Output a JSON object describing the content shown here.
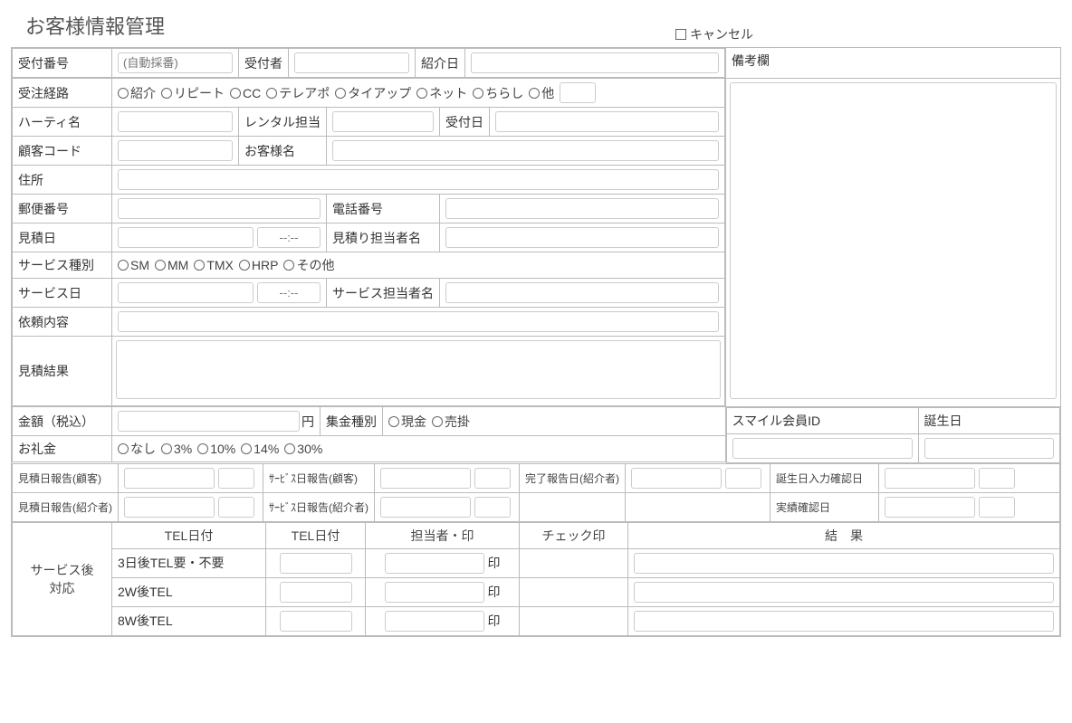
{
  "title": "お客様情報管理",
  "cancel": "キャンセル",
  "labels": {
    "receipt_no": "受付番号",
    "receipt_no_ph": "(自動採番)",
    "receiver": "受付者",
    "intro_date": "紹介日",
    "remarks": "備考欄",
    "order_route": "受注経路",
    "party_name": "ハーティ名",
    "rental_pic": "レンタル担当",
    "receipt_date": "受付日",
    "customer_code": "顧客コード",
    "customer_name": "お客様名",
    "address": "住所",
    "postal": "郵便番号",
    "phone": "電話番号",
    "estimate_date": "見積日",
    "time_ph": "--:--",
    "estimate_pic": "見積り担当者名",
    "service_type": "サービス種別",
    "service_date": "サービス日",
    "service_pic": "サービス担当者名",
    "request": "依頼内容",
    "estimate_result": "見積結果",
    "amount": "金額（税込）",
    "yen": "円",
    "collect_type": "集金種別",
    "gratitude": "お礼金",
    "smile_id": "スマイル会員ID",
    "birthday": "誕生日",
    "est_report_cust": "見積日報告(顧客)",
    "svc_report_cust": "ｻｰﾋﾞｽ日報告(顧客)",
    "done_report_intro": "完了報告日(紹介者)",
    "birth_confirm": "誕生日入力確認日",
    "est_report_intro": "見積日報告(紹介者)",
    "svc_report_intro": "ｻｰﾋﾞｽ日報告(紹介者)",
    "result_confirm": "実績確認日",
    "after_service": "サービス後\n対応",
    "tel_date1": "TEL日付",
    "tel_date2": "TEL日付",
    "pic_stamp": "担当者・印",
    "check_stamp": "チェック印",
    "result": "結　果",
    "stamp": "印",
    "row_3d": "3日後TEL要・不要",
    "row_2w": "2W後TEL",
    "row_8w": "8W後TEL"
  },
  "order_routes": [
    "紹介",
    "リピート",
    "CC",
    "テレアポ",
    "タイアップ",
    "ネット",
    "ちらし",
    "他"
  ],
  "service_types": [
    "SM",
    "MM",
    "TMX",
    "HRP",
    "その他"
  ],
  "collect_types": [
    "現金",
    "売掛"
  ],
  "gratitude_opts": [
    "なし",
    "3%",
    "10%",
    "14%",
    "30%"
  ]
}
